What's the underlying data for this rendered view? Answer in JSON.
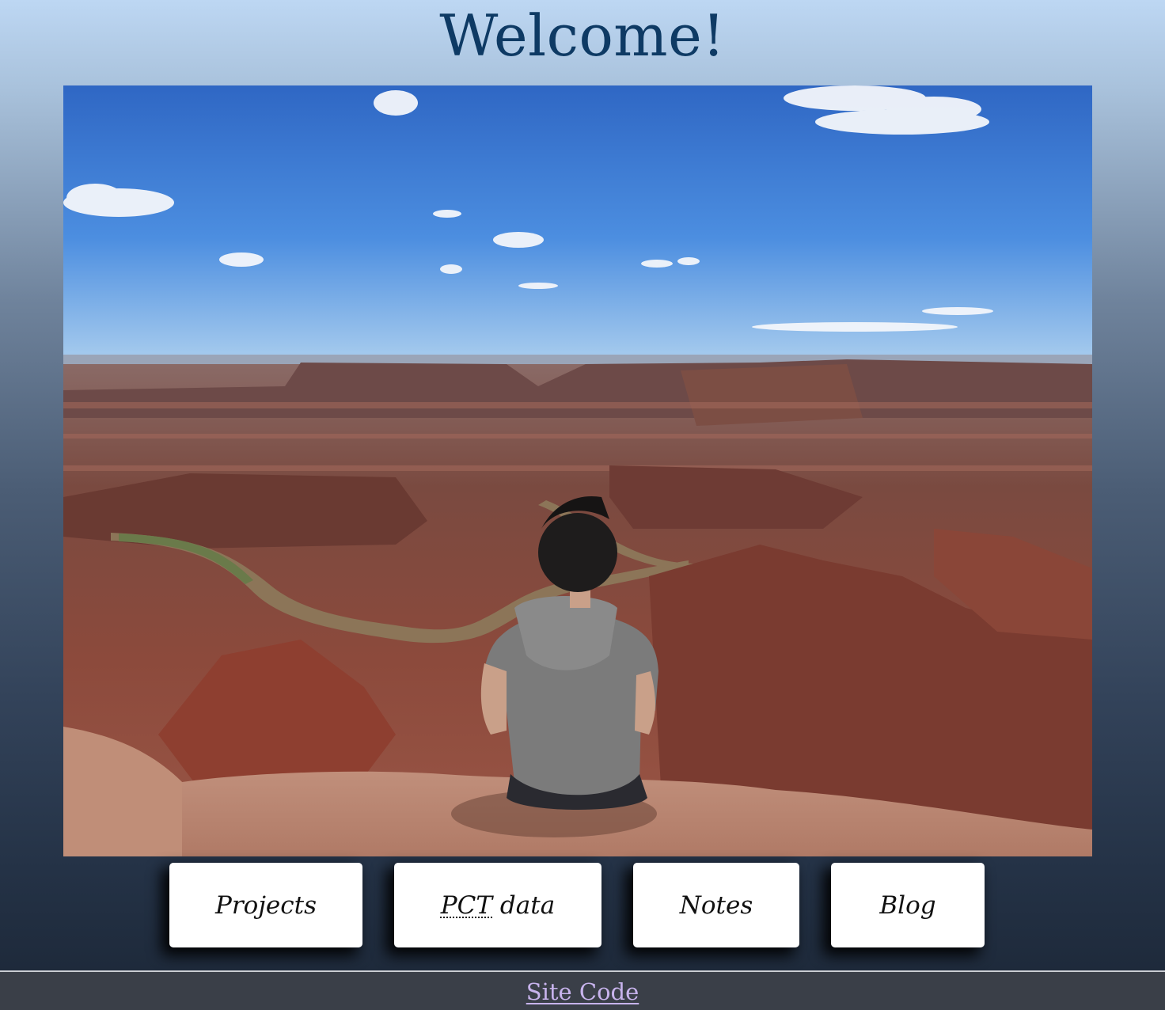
{
  "page": {
    "title": "Welcome!"
  },
  "hero_image": {
    "description": "hero-photo-person-overlooking-canyon"
  },
  "nav": {
    "projects_label": "Projects",
    "pct_abbr": "PCT",
    "pct_rest": " data",
    "notes_label": "Notes",
    "blog_label": "Blog"
  },
  "footer": {
    "site_code_label": "Site Code"
  },
  "colors": {
    "title": "#0e3a64",
    "button_bg": "#ffffff",
    "footer_bg": "#3a3f48",
    "footer_link": "#c7b3ec"
  }
}
